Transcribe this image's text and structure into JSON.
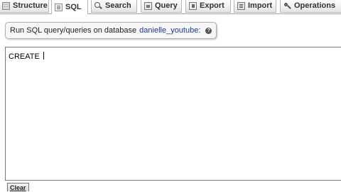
{
  "tabs": [
    {
      "label": "Structure",
      "icon": "structure-icon"
    },
    {
      "label": "SQL",
      "icon": "sql-icon"
    },
    {
      "label": "Search",
      "icon": "search-icon"
    },
    {
      "label": "Query",
      "icon": "query-icon"
    },
    {
      "label": "Export",
      "icon": "export-icon"
    },
    {
      "label": "Import",
      "icon": "import-icon"
    },
    {
      "label": "Operations",
      "icon": "operations-icon"
    }
  ],
  "active_tab": "SQL",
  "legend": {
    "prefix": "Run SQL query/queries on database",
    "database": "danielle_youtube:"
  },
  "editor": {
    "value": "CREATE "
  },
  "clear_button": "Clear"
}
